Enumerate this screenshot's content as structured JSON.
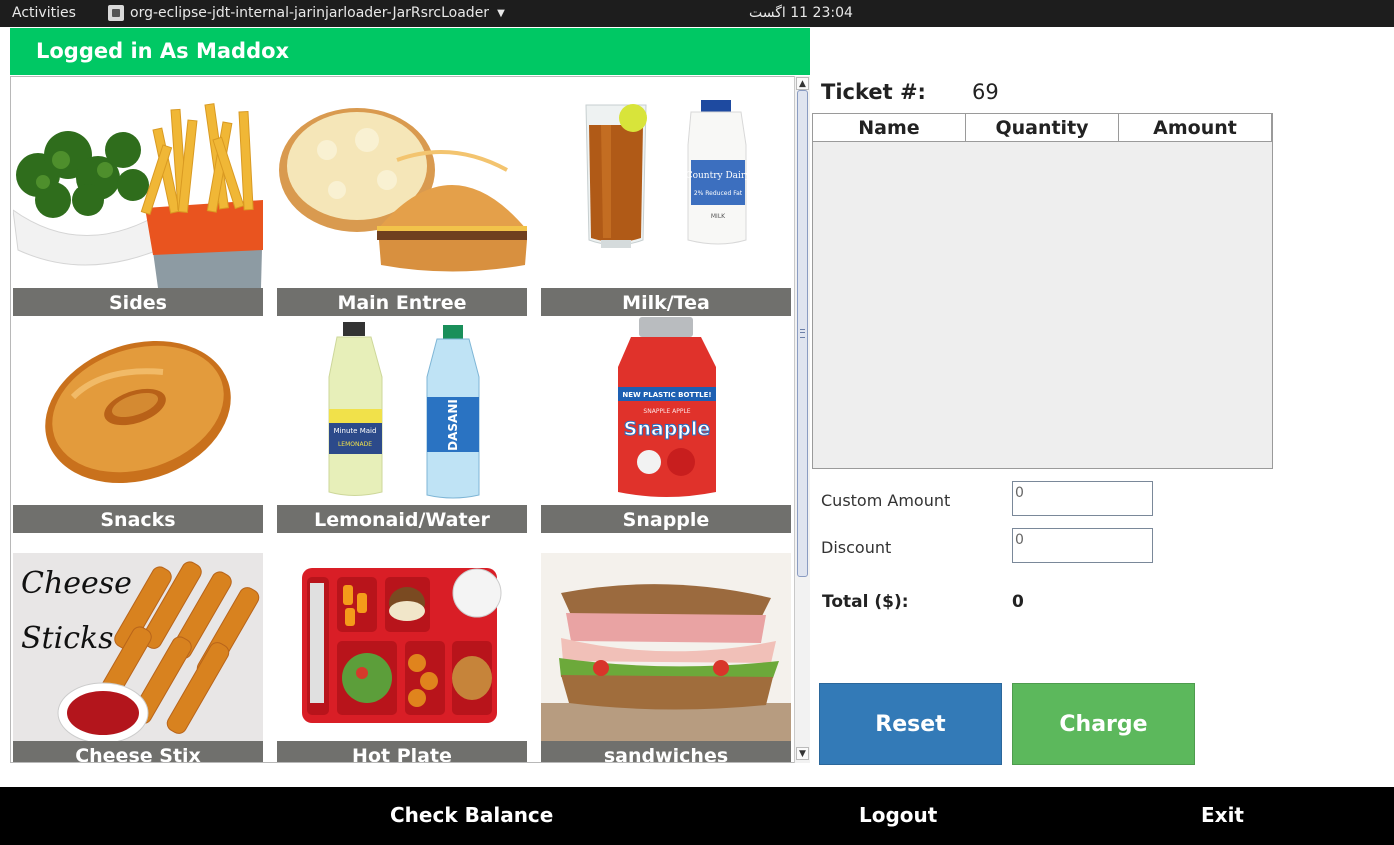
{
  "topbar": {
    "activities": "Activities",
    "app_name": "org-eclipse-jdt-internal-jarinjarloader-JarRsrcLoader",
    "clock": "23:04  11 اگست"
  },
  "header": {
    "login_text": "Logged in As Maddox"
  },
  "categories": [
    {
      "label": "Sides"
    },
    {
      "label": "Main Entree"
    },
    {
      "label": "Milk/Tea"
    },
    {
      "label": "Snacks"
    },
    {
      "label": "Lemonaid/Water"
    },
    {
      "label": "Snapple"
    },
    {
      "label": "Cheese Stix",
      "image_text": [
        "Cheese",
        "Sticks"
      ]
    },
    {
      "label": "Hot Plate"
    },
    {
      "label": "sandwiches"
    }
  ],
  "product_text": {
    "country_dairy": "Country Dairy",
    "reduced_fat": "2% Reduced Fat",
    "milk": "MILK",
    "minute_maid": "Minute Maid",
    "lemonade": "LEMONADE",
    "dasani": "DASANI",
    "snapple_banner": "NEW PLASTIC BOTTLE!",
    "snapple_flavor": "SNAPPLE APPLE",
    "snapple": "Snapple"
  },
  "ticket": {
    "label": "Ticket #:",
    "number": "69",
    "columns": [
      "Name",
      "Quantity",
      "Amount"
    ],
    "rows": []
  },
  "form": {
    "custom_amount_label": "Custom Amount",
    "custom_amount_value": "0",
    "discount_label": "Discount",
    "discount_value": "0",
    "total_label": "Total ($):",
    "total_value": "0"
  },
  "buttons": {
    "reset": "Reset",
    "charge": "Charge"
  },
  "bottom_bar": {
    "check_balance": "Check Balance",
    "logout": "Logout",
    "exit": "Exit"
  },
  "colors": {
    "header_green": "#00c864",
    "tile_label_gray": "#70706d",
    "reset_blue": "#337ab7",
    "charge_green": "#5cb85c"
  }
}
